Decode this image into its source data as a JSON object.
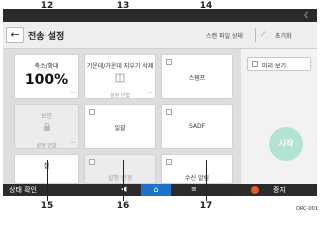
{
  "callouts": {
    "c12": "12",
    "c13": "13",
    "c14": "14",
    "c15": "15",
    "c16": "16",
    "c17": "17"
  },
  "header": {
    "back_icon": "back-arrow-icon",
    "title": "전송 설정",
    "scan_status": "스캔 파일 상태",
    "reset": "초기화"
  },
  "tiles": {
    "zoom": {
      "label": "축소/확대",
      "value": "100%"
    },
    "duplex": {
      "label": "기운데/가운데 지우기 삭제",
      "sub": "설정 안함"
    },
    "stamp": {
      "label": "스탬프"
    },
    "security": {
      "label": "보안",
      "sub": "설정 안함"
    },
    "batch": {
      "label": "일괄"
    },
    "sadf": {
      "label": "SADF"
    },
    "bind": {
      "label": "철"
    },
    "split": {
      "label": "설정 변경"
    },
    "receive": {
      "label": "수신 알림"
    }
  },
  "right": {
    "preview_label": "미리 보기",
    "start": "시작"
  },
  "bottom": {
    "status": "상태 확인",
    "stop": "중지"
  },
  "watermark": "DRC-001"
}
